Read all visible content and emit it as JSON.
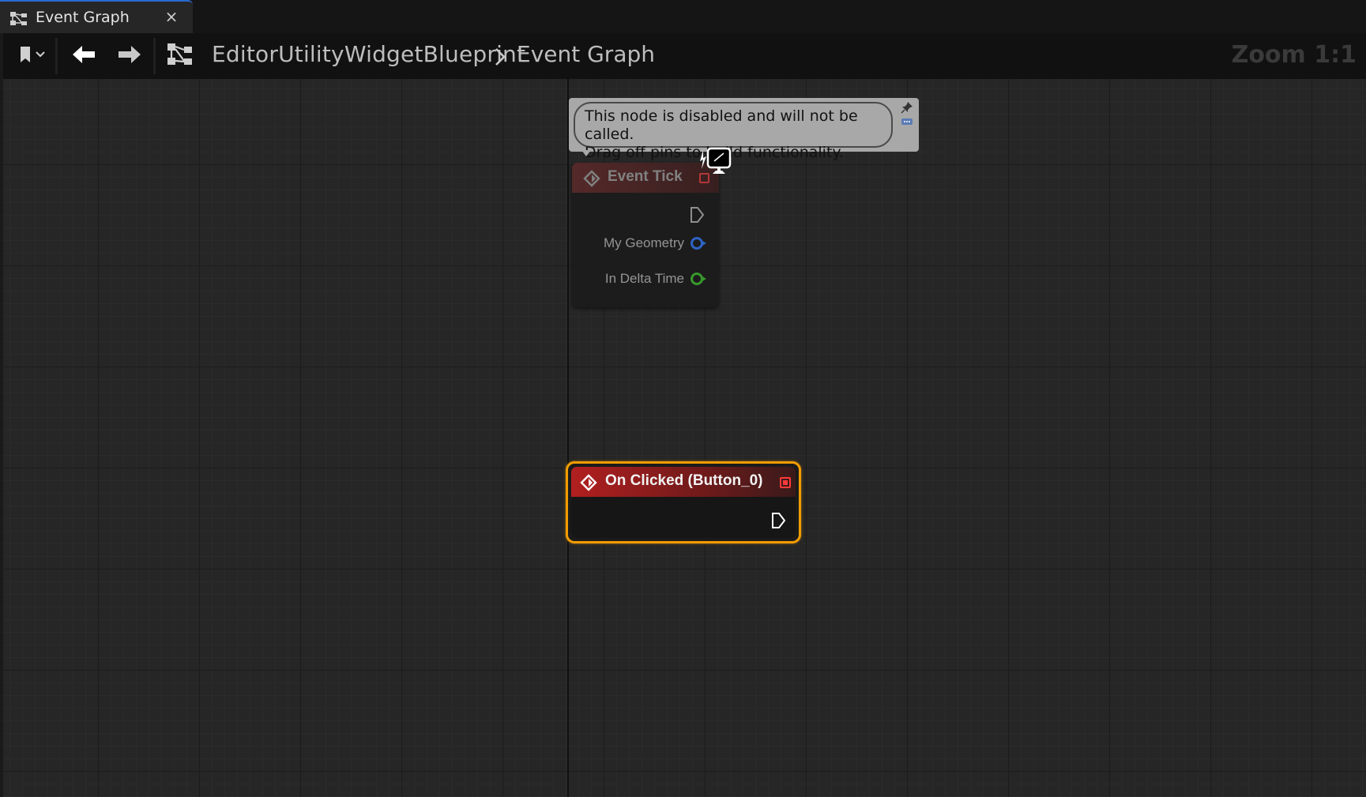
{
  "tab": {
    "title": "Event Graph",
    "close_glyph": "×",
    "icon": "graph-icon"
  },
  "toolbar": {
    "bookmark_icon": "bookmark-icon",
    "back_icon": "arrow-left-icon",
    "forward_icon": "arrow-right-icon",
    "breadcrumb_root": "EditorUtilityWidgetBlueprint",
    "breadcrumb_current": "Event Graph",
    "zoom": "Zoom 1:1"
  },
  "comment": {
    "line1": "This node is disabled and will not be called.",
    "line2": "Drag off pins to build functionality."
  },
  "nodes": {
    "event_tick": {
      "title": "Event Tick",
      "pins": [
        {
          "label": "My Geometry",
          "color": "#2e6bd6"
        },
        {
          "label": "In Delta Time",
          "color": "#3aa52d"
        }
      ]
    },
    "on_clicked": {
      "title": "On Clicked (Button_0)",
      "border_color": "#f19c00",
      "header_color": "#b21f1f"
    }
  }
}
